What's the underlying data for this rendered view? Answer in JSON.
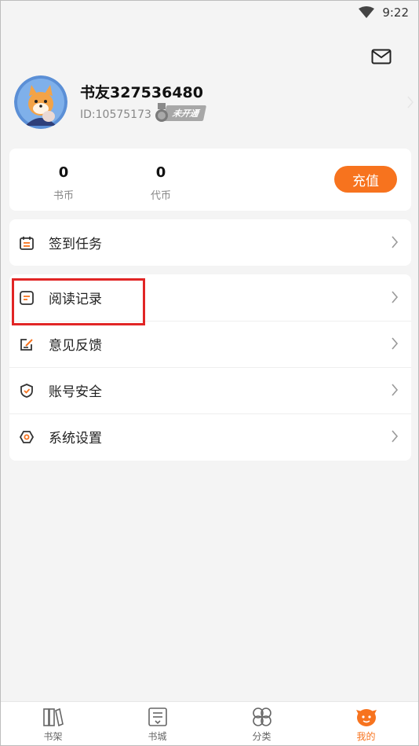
{
  "status_bar": {
    "time": "9:22"
  },
  "profile": {
    "username": "书友327536480",
    "user_id": "ID:10575173",
    "vip_status": "未开通"
  },
  "wallet": {
    "coins": {
      "value": "0",
      "label": "书币"
    },
    "vouchers": {
      "value": "0",
      "label": "代币"
    },
    "recharge_label": "充值"
  },
  "menu": {
    "sign_in": "签到任务",
    "reading_history": "阅读记录",
    "feedback": "意见反馈",
    "account_security": "账号安全",
    "settings": "系统设置"
  },
  "tabs": [
    {
      "label": "书架",
      "icon": "bookshelf-icon",
      "active": false
    },
    {
      "label": "书城",
      "icon": "bookstore-icon",
      "active": false
    },
    {
      "label": "分类",
      "icon": "category-icon",
      "active": false
    },
    {
      "label": "我的",
      "icon": "profile-icon",
      "active": true
    }
  ],
  "colors": {
    "accent": "#f7731e",
    "highlight": "#e12525"
  }
}
